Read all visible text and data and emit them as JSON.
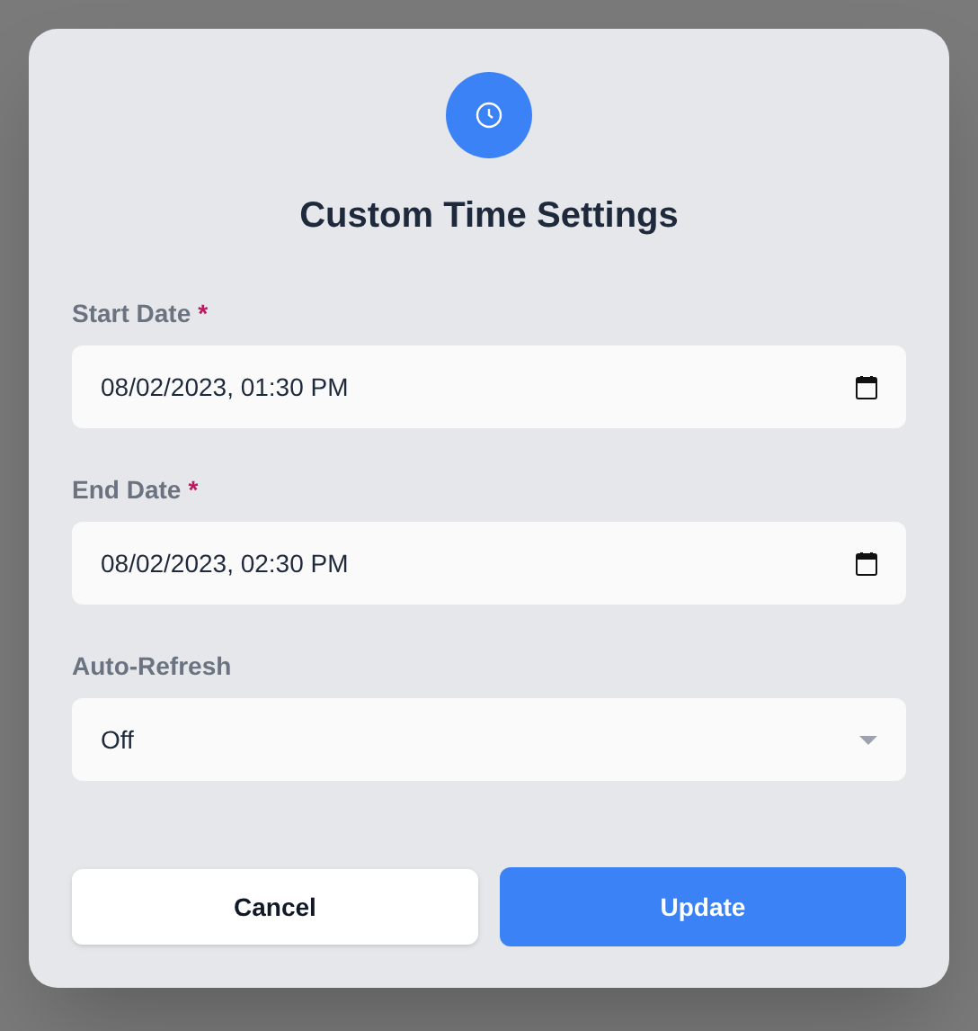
{
  "dialog": {
    "title": "Custom Time Settings",
    "fields": [
      {
        "kind": "datetime",
        "label": "Start Date",
        "required_mark": "*",
        "value": "08/02/2023, 01:30 PM"
      },
      {
        "kind": "datetime",
        "label": "End Date",
        "required_mark": "*",
        "value": "08/02/2023, 02:30 PM"
      },
      {
        "kind": "select",
        "label": "Auto-Refresh",
        "value": "Off"
      }
    ],
    "buttons": [
      {
        "kind": "secondary",
        "label": "Cancel"
      },
      {
        "kind": "primary",
        "label": "Update"
      }
    ]
  }
}
